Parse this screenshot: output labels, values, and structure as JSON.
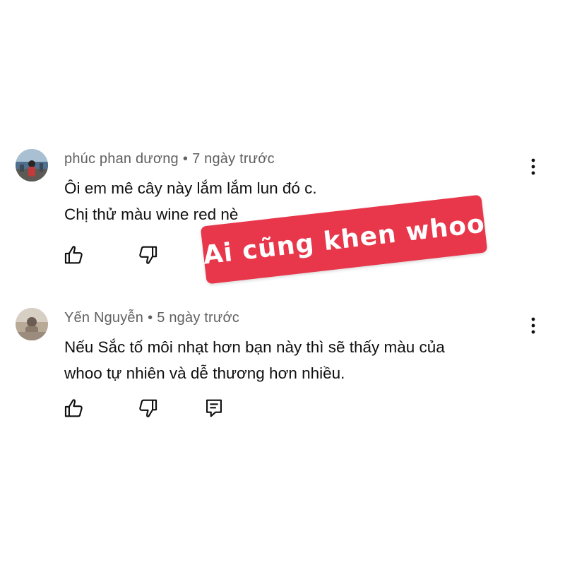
{
  "comments": [
    {
      "author": "phúc phan dương",
      "time": "7 ngày trước",
      "text_lines": [
        "Ôi em mê cây này lắm lắm lun đó c.",
        "Chị thử màu wine red nè"
      ],
      "actions": {
        "like_icon": "thumbs-up-icon",
        "dislike_icon": "thumbs-down-icon"
      }
    },
    {
      "author": "Yến Nguyễn",
      "time": "5 ngày trước",
      "text_lines": [
        "Nếu Sắc tố môi nhạt hơn bạn này thì sẽ thấy màu của",
        "whoo tự nhiên và dễ thương hơn nhiều."
      ],
      "actions": {
        "like_icon": "thumbs-up-icon",
        "dislike_icon": "thumbs-down-icon",
        "reply_icon": "reply-icon"
      }
    }
  ],
  "overlay": {
    "label": "Ai cũng khen whoo",
    "background": "#e8364a",
    "text_color": "#ffffff"
  },
  "colors": {
    "meta_text": "#606060",
    "body_text": "#0f0f0f",
    "icon": "#0f0f0f"
  },
  "separator": "•"
}
